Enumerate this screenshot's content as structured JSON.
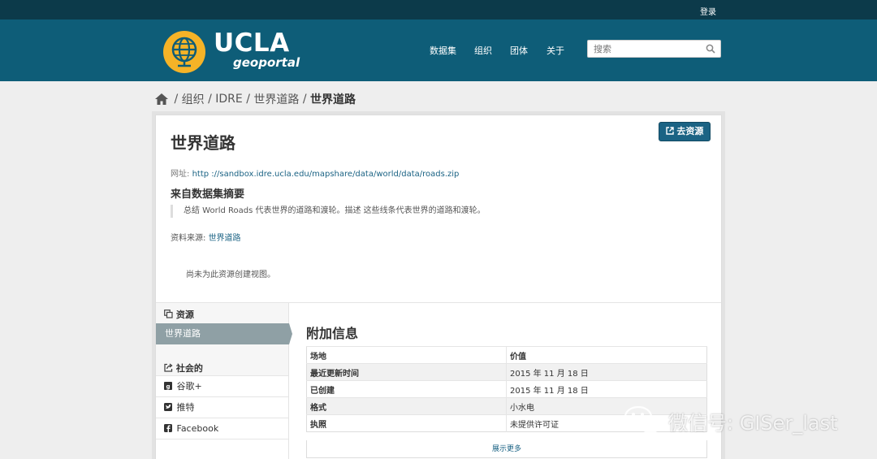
{
  "topbar": {
    "login": "登录"
  },
  "logo": {
    "name": "UCLA",
    "sub": "geoportal"
  },
  "nav": {
    "items": [
      "数据集",
      "组织",
      "团体",
      "关于"
    ]
  },
  "search": {
    "placeholder": "搜索"
  },
  "breadcrumb": {
    "items": [
      "组织",
      "IDRE",
      "世界道路"
    ],
    "current": "世界道路"
  },
  "dataset": {
    "title": "世界道路",
    "goto_button": "去资源",
    "url_label": "网址:",
    "url": "http ://sandbox.idre.ucla.edu/mapshare/data/world/data/roads.zip",
    "summary_heading": "来自数据集摘要",
    "summary": "总结 World Roads 代表世界的道路和渡轮。描述 这些线条代表世界的道路和渡轮。",
    "source_label": "资料来源:",
    "source_link": "世界道路",
    "no_view": "尚未为此资源创建视图。"
  },
  "sidebar": {
    "resources_heading": "资源",
    "active_resource": "世界道路",
    "social_heading": "社会的",
    "social": [
      "谷歌+",
      "推特",
      "Facebook"
    ]
  },
  "extra": {
    "heading": "附加信息",
    "columns": [
      "场地",
      "价值"
    ],
    "rows": [
      [
        "最近更新时间",
        "2015 年 11 月 18 日"
      ],
      [
        "已创建",
        "2015 年 11 月 18 日"
      ],
      [
        "格式",
        "小水电"
      ],
      [
        "执照",
        "未提供许可证"
      ]
    ],
    "show_more": "展示更多"
  },
  "watermark": {
    "text": "微信号: GISer_last"
  },
  "colors": {
    "header": "#0e5d78",
    "topbar": "#0c3a4a",
    "accent": "#1b6384",
    "logo_globe": "#f5b327"
  }
}
